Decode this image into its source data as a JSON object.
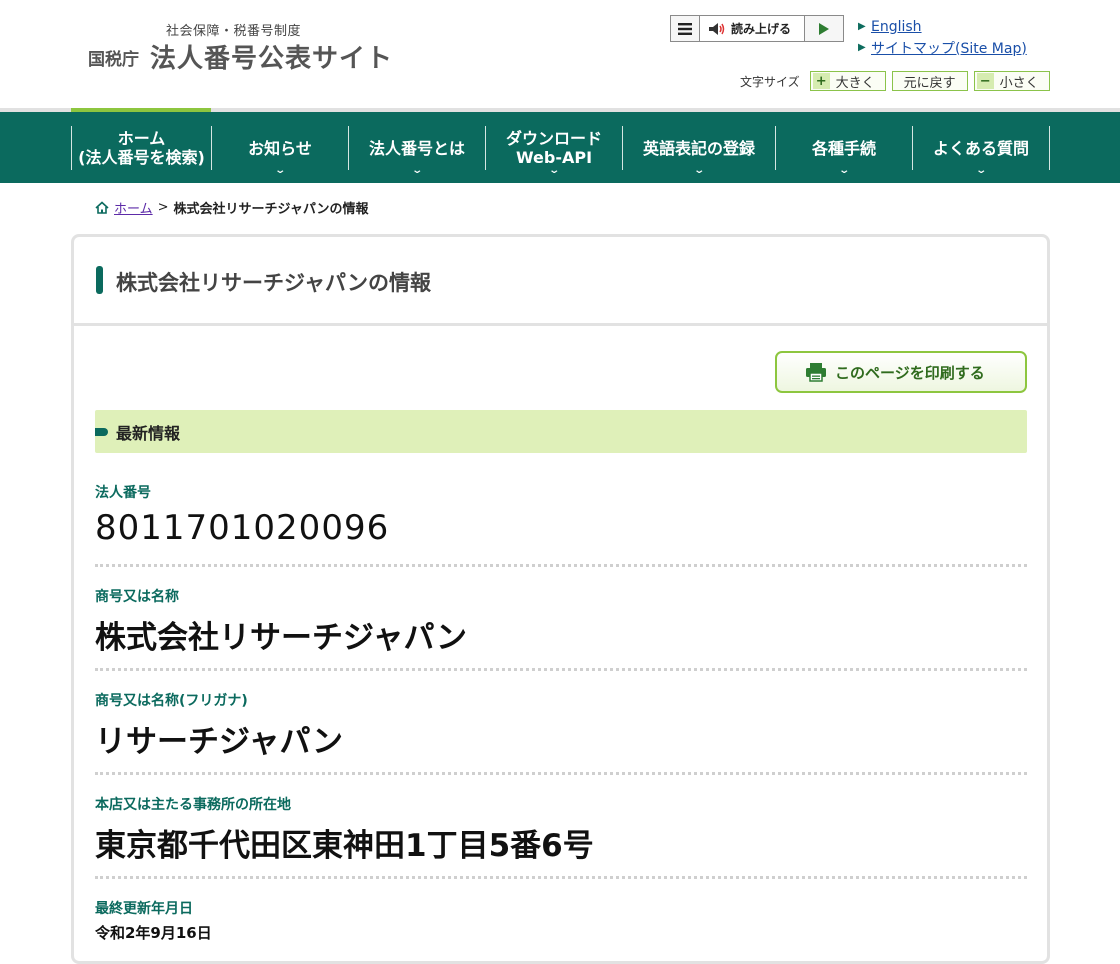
{
  "header": {
    "logo_sub": "社会保障・税番号制度",
    "logo_agency": "国税庁",
    "logo_main": "法人番号公表サイト",
    "reader_label": "読み上げる",
    "links": [
      {
        "label": "English"
      },
      {
        "label": "サイトマップ(Site Map)"
      }
    ],
    "font_size_label": "文字サイズ",
    "font_large": "大きく",
    "font_reset": "元に戻す",
    "font_small": "小さく"
  },
  "nav": {
    "items": [
      {
        "label": "ホーム\n(法人番号を検索)",
        "has_dropdown": false
      },
      {
        "label": "お知らせ",
        "has_dropdown": true
      },
      {
        "label": "法人番号とは",
        "has_dropdown": true
      },
      {
        "label": "ダウンロード\nWeb-API",
        "has_dropdown": true
      },
      {
        "label": "英語表記の登録",
        "has_dropdown": true
      },
      {
        "label": "各種手続",
        "has_dropdown": true
      },
      {
        "label": "よくある質問",
        "has_dropdown": true
      }
    ]
  },
  "breadcrumb": {
    "home": "ホーム",
    "separator": ">",
    "current": "株式会社リサーチジャパンの情報"
  },
  "main": {
    "title": "株式会社リサーチジャパンの情報",
    "print_label": "このページを印刷する",
    "section_title": "最新情報",
    "fields": {
      "corp_number": {
        "label": "法人番号",
        "value": "8011701020096"
      },
      "name": {
        "label": "商号又は名称",
        "value": "株式会社リサーチジャパン"
      },
      "furigana": {
        "label": "商号又は名称(フリガナ)",
        "value": "リサーチジャパン"
      },
      "address": {
        "label": "本店又は主たる事務所の所在地",
        "value": "東京都千代田区東神田1丁目5番6号"
      },
      "updated": {
        "label": "最終更新年月日",
        "value": "令和2年9月16日"
      }
    }
  },
  "colors": {
    "nav_bg": "#0b6a5e",
    "accent_green": "#8dc63f",
    "section_bg": "#dff0b9",
    "label_color": "#0b6a5e"
  }
}
